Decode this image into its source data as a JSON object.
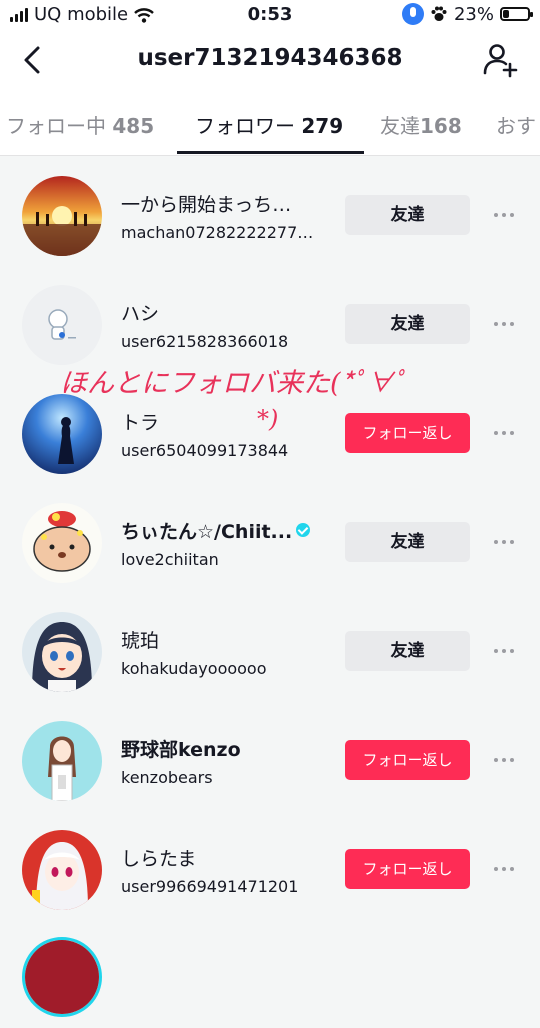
{
  "status_bar": {
    "carrier": "UQ mobile",
    "time": "0:53",
    "battery_percent": "23%",
    "battery_level": 0.23
  },
  "header": {
    "title": "user7132194346368"
  },
  "tabs": [
    {
      "label": "フォロー中",
      "count": "485"
    },
    {
      "label": "フォロワー",
      "count": "279"
    },
    {
      "label": "友達",
      "count": "168"
    },
    {
      "label": "おす",
      "count": ""
    }
  ],
  "annotation": {
    "line1": "ほんとにフォロバ来た(*ﾟ∀ﾟ",
    "line2": "*)"
  },
  "followers": [
    {
      "name": "一から開始まっち…",
      "username": "machan07282222277…",
      "button": "友達",
      "button_style": "friend",
      "verified": false
    },
    {
      "name": "ハシ",
      "username": "user6215828366018",
      "button": "友達",
      "button_style": "friend",
      "verified": false
    },
    {
      "name": "トラ",
      "username": "user6504099173844",
      "button": "フォロー返し",
      "button_style": "followback",
      "verified": false
    },
    {
      "name": "ちぃたん☆/Chiit...",
      "username": "love2chiitan",
      "button": "友達",
      "button_style": "friend",
      "verified": true
    },
    {
      "name": "琥珀",
      "username": "kohakudayoooooo",
      "button": "友達",
      "button_style": "friend",
      "verified": false
    },
    {
      "name": "野球部kenzo",
      "username": "kenzobears",
      "button": "フォロー返し",
      "button_style": "followback",
      "verified": false
    },
    {
      "name": "しらたま",
      "username": "user99669491471201",
      "button": "フォロー返し",
      "button_style": "followback",
      "verified": false
    }
  ],
  "colors": {
    "accent": "#fe2c55",
    "friend_button": "#e9eaec",
    "verified": "#20d5ec",
    "annotation": "#e8325a"
  }
}
